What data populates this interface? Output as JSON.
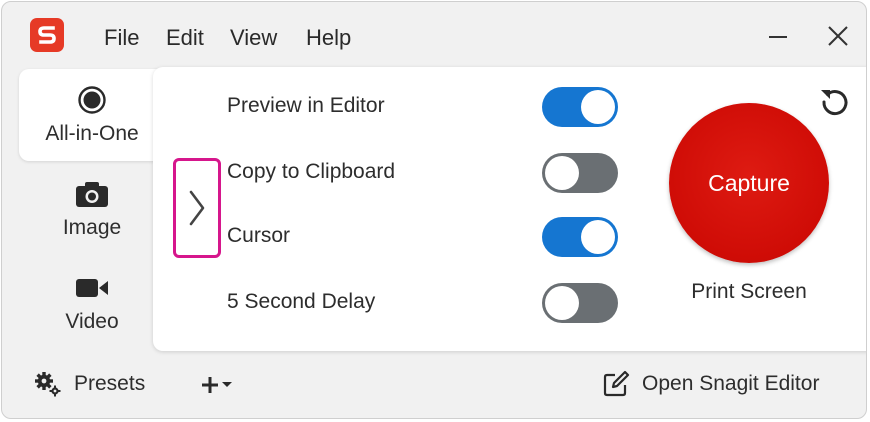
{
  "app": {
    "logo_letter": "S",
    "brand_color": "#e63a26"
  },
  "menu": [
    "File",
    "Edit",
    "View",
    "Help"
  ],
  "window_controls": [
    "minimize-icon",
    "close-icon"
  ],
  "modes": [
    {
      "label": "All-in-One",
      "icon": "all-in-one-icon",
      "active": true
    },
    {
      "label": "Image",
      "icon": "camera-icon",
      "active": false
    },
    {
      "label": "Video",
      "icon": "video-camera-icon",
      "active": false
    }
  ],
  "settings": [
    {
      "label": "Preview in Editor",
      "on": true
    },
    {
      "label": "Copy to Clipboard",
      "on": false
    },
    {
      "label": "Cursor",
      "on": true
    },
    {
      "label": "5 Second Delay",
      "on": false
    }
  ],
  "capture": {
    "label": "Capture",
    "hotkey": "Print Screen",
    "color": "#d0100a"
  },
  "bottom": {
    "presets_label": "Presets",
    "add_icon": "plus-dropdown-icon",
    "open_editor_label": "Open Snagit Editor"
  },
  "colors": {
    "toggle_on": "#1576d1",
    "toggle_off": "#6a6f73",
    "highlight_border": "#d6168c"
  }
}
